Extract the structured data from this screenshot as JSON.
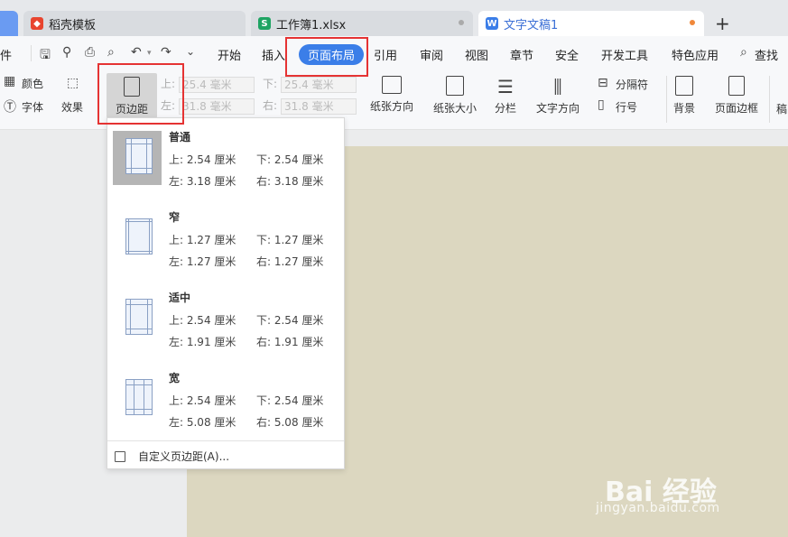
{
  "tabs": [
    {
      "label": "稻壳模板",
      "icon": "daoke-icon",
      "icon_color": "#e8452f"
    },
    {
      "label": "工作簿1.xlsx",
      "icon": "spreadsheet-icon",
      "icon_color": "#1fa463"
    },
    {
      "label": "文字文稿1",
      "icon": "writer-icon",
      "icon_color": "#3b7ee8",
      "active": true
    }
  ],
  "new_tab": "+",
  "menu": {
    "file_stub": "件",
    "items": [
      "开始",
      "插入",
      "页面布局",
      "引用",
      "审阅",
      "视图",
      "章节",
      "安全",
      "开发工具",
      "特色应用"
    ],
    "active": "页面布局",
    "search": "查找"
  },
  "ribbon": {
    "color": "颜色",
    "font": "字体",
    "effect": "效果",
    "margin": "页边距",
    "top_label": "上:",
    "top_value": "25.4 毫米",
    "bottom_label": "下:",
    "bottom_value": "25.4 毫米",
    "left_label": "左:",
    "left_value": "31.8 毫米",
    "right_label": "右:",
    "right_value": "31.8 毫米",
    "orientation": "纸张方向",
    "size": "纸张大小",
    "columns": "分栏",
    "text_direction": "文字方向",
    "separator": "分隔符",
    "line_number": "行号",
    "background": "背景",
    "page_border": "页面边框",
    "more": "稿"
  },
  "margin_presets": [
    {
      "name": "普通",
      "top": "上: 2.54 厘米",
      "bottom": "下: 2.54 厘米",
      "left": "左: 3.18 厘米",
      "right": "右: 3.18 厘米",
      "selected": true
    },
    {
      "name": "窄",
      "top": "上: 1.27 厘米",
      "bottom": "下: 1.27 厘米",
      "left": "左: 1.27 厘米",
      "right": "右: 1.27 厘米"
    },
    {
      "name": "适中",
      "top": "上: 2.54 厘米",
      "bottom": "下: 2.54 厘米",
      "left": "左: 1.91 厘米",
      "right": "右: 1.91 厘米"
    },
    {
      "name": "宽",
      "top": "上: 2.54 厘米",
      "bottom": "下: 2.54 厘米",
      "left": "左: 5.08 厘米",
      "right": "右: 5.08 厘米"
    }
  ],
  "custom_margin": "自定义页边距(A)...",
  "watermark": {
    "brand": "Bai 经验",
    "url": "jingyan.baidu.com"
  },
  "colors": {
    "accent": "#3b7ee8",
    "highlight": "#e53333",
    "page": "#dcd7c0"
  }
}
